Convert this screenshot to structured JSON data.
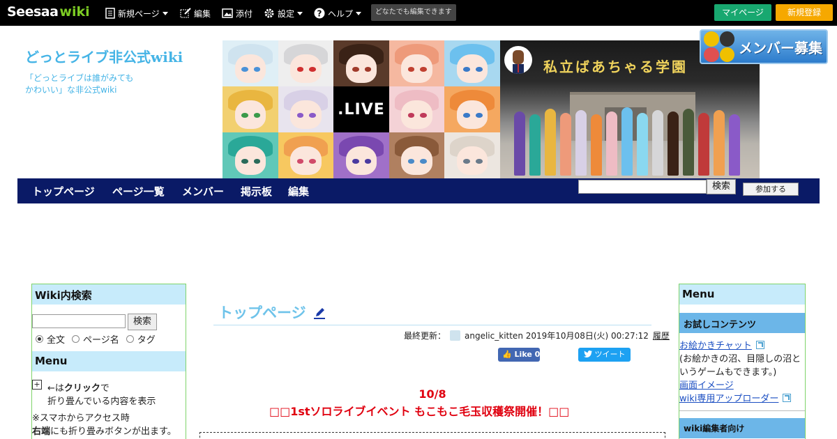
{
  "topbar": {
    "logo_seesaa": "Seesaa",
    "logo_wiki": "wiki",
    "new_page": "新規ページ",
    "edit": "編集",
    "attach": "添付",
    "settings": "設定",
    "help": "ヘルプ",
    "anyone_can_edit": "どなたでも編集できます",
    "mypage": "マイページ",
    "register": "新規登録"
  },
  "header": {
    "site_title": "どっとライブ非公式wiki",
    "desc_line1": "「どっとライブは誰がみても",
    "desc_line2": "かわいい」な非公式wiki",
    "live_tile": ".LIVE",
    "school_sign": "私立ばあちゃる学園",
    "recruit": "メンバー募集"
  },
  "nav": {
    "items": [
      "トップページ",
      "ページ一覧",
      "メンバー",
      "掲示板",
      "編集"
    ],
    "search_button": "検索",
    "join_button": "参加する"
  },
  "sidebar_left": {
    "search_title": "Wiki内検索",
    "search_button": "検索",
    "radio_full": "全文",
    "radio_page": "ページ名",
    "radio_tag": "タグ",
    "menu_title": "Menu",
    "plus": "+",
    "line1_a": "←は",
    "line1_b": "クリック",
    "line1_c": "で",
    "line2": "折り畳んでいる内容を表示",
    "line3": "※スマホからアクセス時",
    "line4_a": "右端",
    "line4_b": "にも折り畳みボタンが出ます。"
  },
  "content": {
    "page_title": "トップページ",
    "updated_label": "最終更新：",
    "updated_user": "angelic_kitten",
    "updated_time": "2019年10月08日(火) 00:27:12",
    "history": "履歴",
    "fb_like": "Like 0",
    "tweet": "ツイート",
    "event_date": "10/8",
    "event_title": "□□1stソロライブイベント もこもこ毛玉収穫祭開催！□□"
  },
  "sidebar_right": {
    "menu_title": "Menu",
    "trial_title": "お試しコンテンツ",
    "link_chat": "お絵かきチャット",
    "chat_desc1": "(お絵かきの沼、目隠しの沼と",
    "chat_desc2": "いうゲームもできます。)",
    "link_screen": "画面イメージ",
    "link_uploader": "wiki専用アップローダー",
    "editors_title": "wiki編集者向け"
  },
  "colors": {
    "title_blue": "#45b4e6",
    "nav_navy": "#0a1a66",
    "event_red": "#e0000f",
    "sidebar_head": "#c7ebfb",
    "sidebar_border": "#7ed36a"
  }
}
